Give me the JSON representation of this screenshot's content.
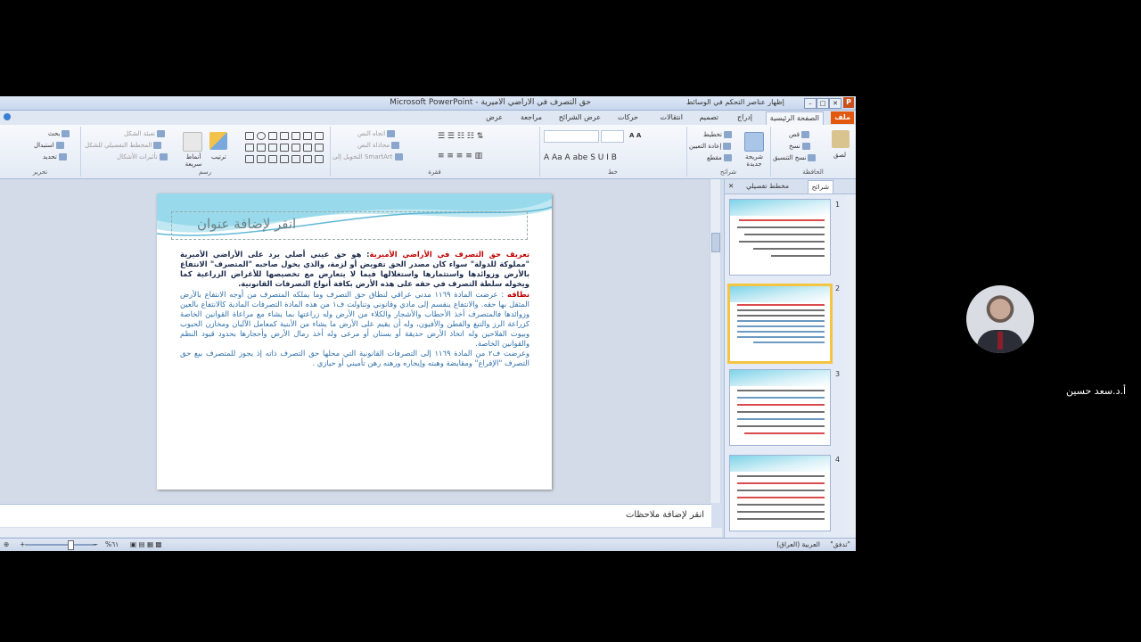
{
  "window": {
    "title": "Microsoft PowerPoint - حق التصرف في الأراضي الأميرية",
    "extra_title": "إظهار عناصر التحكم في الوسائط"
  },
  "tabs": {
    "file": "ملف",
    "home": "الصفحة الرئيسية",
    "insert": "إدراج",
    "design": "تصميم",
    "transitions": "انتقالات",
    "animations": "حركات",
    "slideshow": "عرض الشرائح",
    "review": "مراجعة",
    "view": "عرض"
  },
  "ribbon": {
    "clipboard": {
      "label": "الحافظة",
      "paste": "لصق",
      "cut": "قص",
      "copy": "نسخ",
      "format_painter": "نسخ التنسيق"
    },
    "slides": {
      "label": "شرائح",
      "new_slide": "شريحة جديدة",
      "layout": "تخطيط",
      "reset": "إعادة التعيين",
      "section": "مقطع"
    },
    "font": {
      "label": "خط"
    },
    "paragraph": {
      "label": "فقرة",
      "text_direction": "اتجاه النص",
      "align_text": "محاذاة النص",
      "smartart": "التحويل إلى SmartArt"
    },
    "drawing": {
      "label": "رسم",
      "arrange": "ترتيب",
      "quick_styles": "أنماط سريعة",
      "shape_fill": "تعبئة الشكل",
      "shape_outline": "المخطط التفصيلي للشكل",
      "shape_effects": "تأثيرات الأشكال"
    },
    "editing": {
      "label": "تحرير",
      "find": "بحث",
      "replace": "استبدال",
      "select": "تحديد"
    }
  },
  "slide": {
    "title_placeholder": "انقر لإضافة عنوان",
    "p1_heading": "تعريف حق التصرف في الأراضي الأميرية",
    "p1_text": ": هو حق عيني أصلي يرد على الأراضي الأميرية \"مملوكة للدولة\" سواء كان مصدر الحق تفويض أو لزمة، والذي يخول صاحبه \"المتصرف\" الانتفاع بالأرض وزوائدها واستثمارها واستغلالها فيما لا يتعارض مع تخصيصها للأغراض الزراعية كما ويخوله سلطة التصرف في حقه على هذه الأرض بكافة أنواع التصرفات القانونية.",
    "p2_heading": "نطاقه",
    "p2_text": " : عرضت المادة ١١٦٩ مدني عراقي لنطاق حق التصرف وما يملكه المتصرف من أوجه الانتفاع بالأرض المثقل بها حقه. والانتفاع ينقسم إلى مادي وقانوني وتناولت ف١ من هذه المادة التصرفات المادية كالانتفاع بالعين وزوائدها فالمتصرف أخذ الأحطاب والأشجار والكلاء من الأرض وله زراعتها بما يشاء مع مراعاة القوانين الخاصة كزراعة الرز والتبغ والقطن والأفيون، وله أن يقيم على الأرض ما يشاء من الأبنية كمعامل الآلبان ومخازن الحبوب وبيوت الفلاحين وله اتخاذ الأرض حديقة أو بستان أو مرعى وله أخذ رمال الأرض وأحجارها بحدود قيود النظم والقوانين الخاصة.",
    "p3_text": "وعرضت ف٢ من المادة ١١٦٩ إلى التصرفات القانونية التي محلها حق التصرف ذاته إذ يجوز للمتصرف بيع حق التصرف \"الإفراغ\" ومقايضة وهبته وإيجاره ورهنه رهن تأميني أو حيازي ."
  },
  "notes": {
    "placeholder": "انقر لإضافة ملاحظات"
  },
  "panel": {
    "tab_slides": "شرائح",
    "tab_outline": "مخطط تفصيلي",
    "thumbs": [
      "1",
      "2",
      "3",
      "4"
    ],
    "selected": 2
  },
  "status": {
    "theme": "\"تدفق\"",
    "language": "العربية (العراق)",
    "zoom": "%٦١"
  },
  "video": {
    "speaker_name": "أ.د.سعد حسين"
  }
}
